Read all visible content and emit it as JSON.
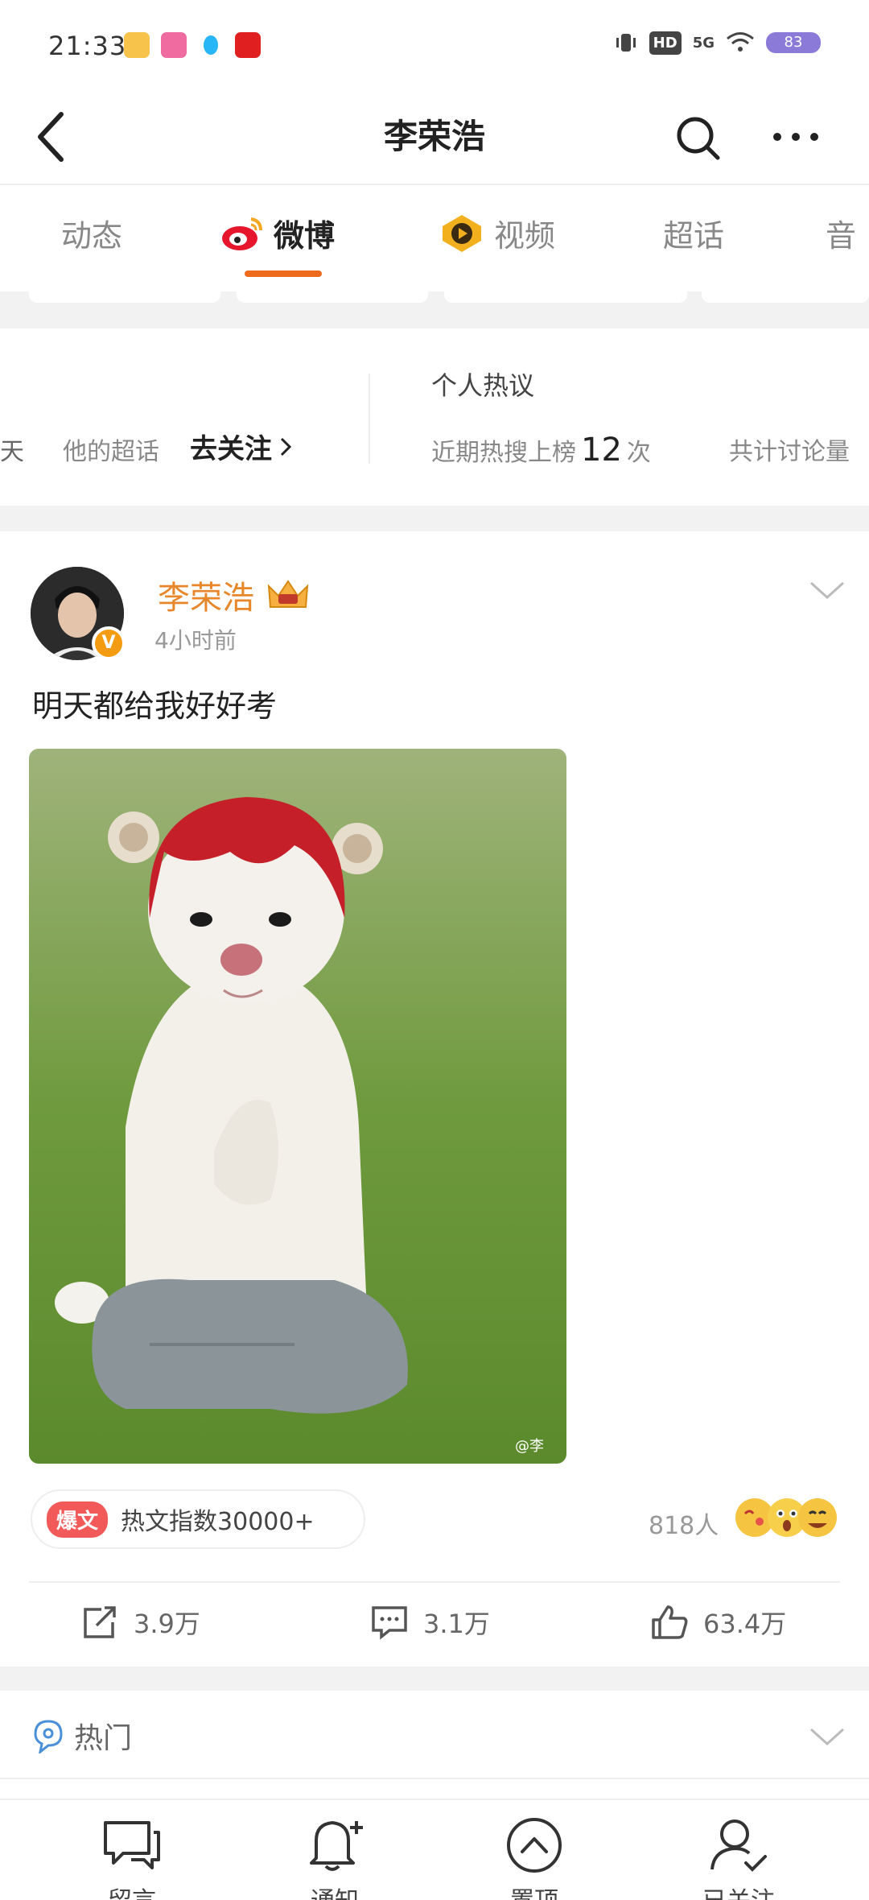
{
  "status_bar": {
    "time": "21:33",
    "network": "5G",
    "hd": "HD",
    "battery": "83"
  },
  "header": {
    "title": "李荣浩"
  },
  "tabs": [
    {
      "label": "动态"
    },
    {
      "label": "微博"
    },
    {
      "label": "视频"
    },
    {
      "label": "超话"
    },
    {
      "label": "音"
    }
  ],
  "stats": {
    "cut_left": "天",
    "supertopic_label": "他的超话",
    "follow_link": "去关注",
    "personal_title": "个人热议",
    "hot_search_prefix": "近期热搜上榜",
    "hot_search_count": "12",
    "hot_search_suffix": "次",
    "discussion_label": "共计讨论量"
  },
  "post": {
    "author": "李荣浩",
    "time": "4小时前",
    "text": "明天都给我好好考",
    "watermark": "@李",
    "hot_badge": "爆文",
    "hot_index": "热文指数30000+",
    "readers": "818人",
    "actions": {
      "share": "3.9万",
      "comment": "3.1万",
      "like": "63.4万"
    }
  },
  "hot_section": {
    "label": "热门"
  },
  "bottom_nav": [
    {
      "label": "留言"
    },
    {
      "label": "通知"
    },
    {
      "label": "置顶"
    },
    {
      "label": "已关注"
    }
  ],
  "colors": {
    "accent": "#ee6b1e",
    "author": "#e8862a",
    "hot_badge": "#f25a5a",
    "battery": "#8b7ad8"
  }
}
